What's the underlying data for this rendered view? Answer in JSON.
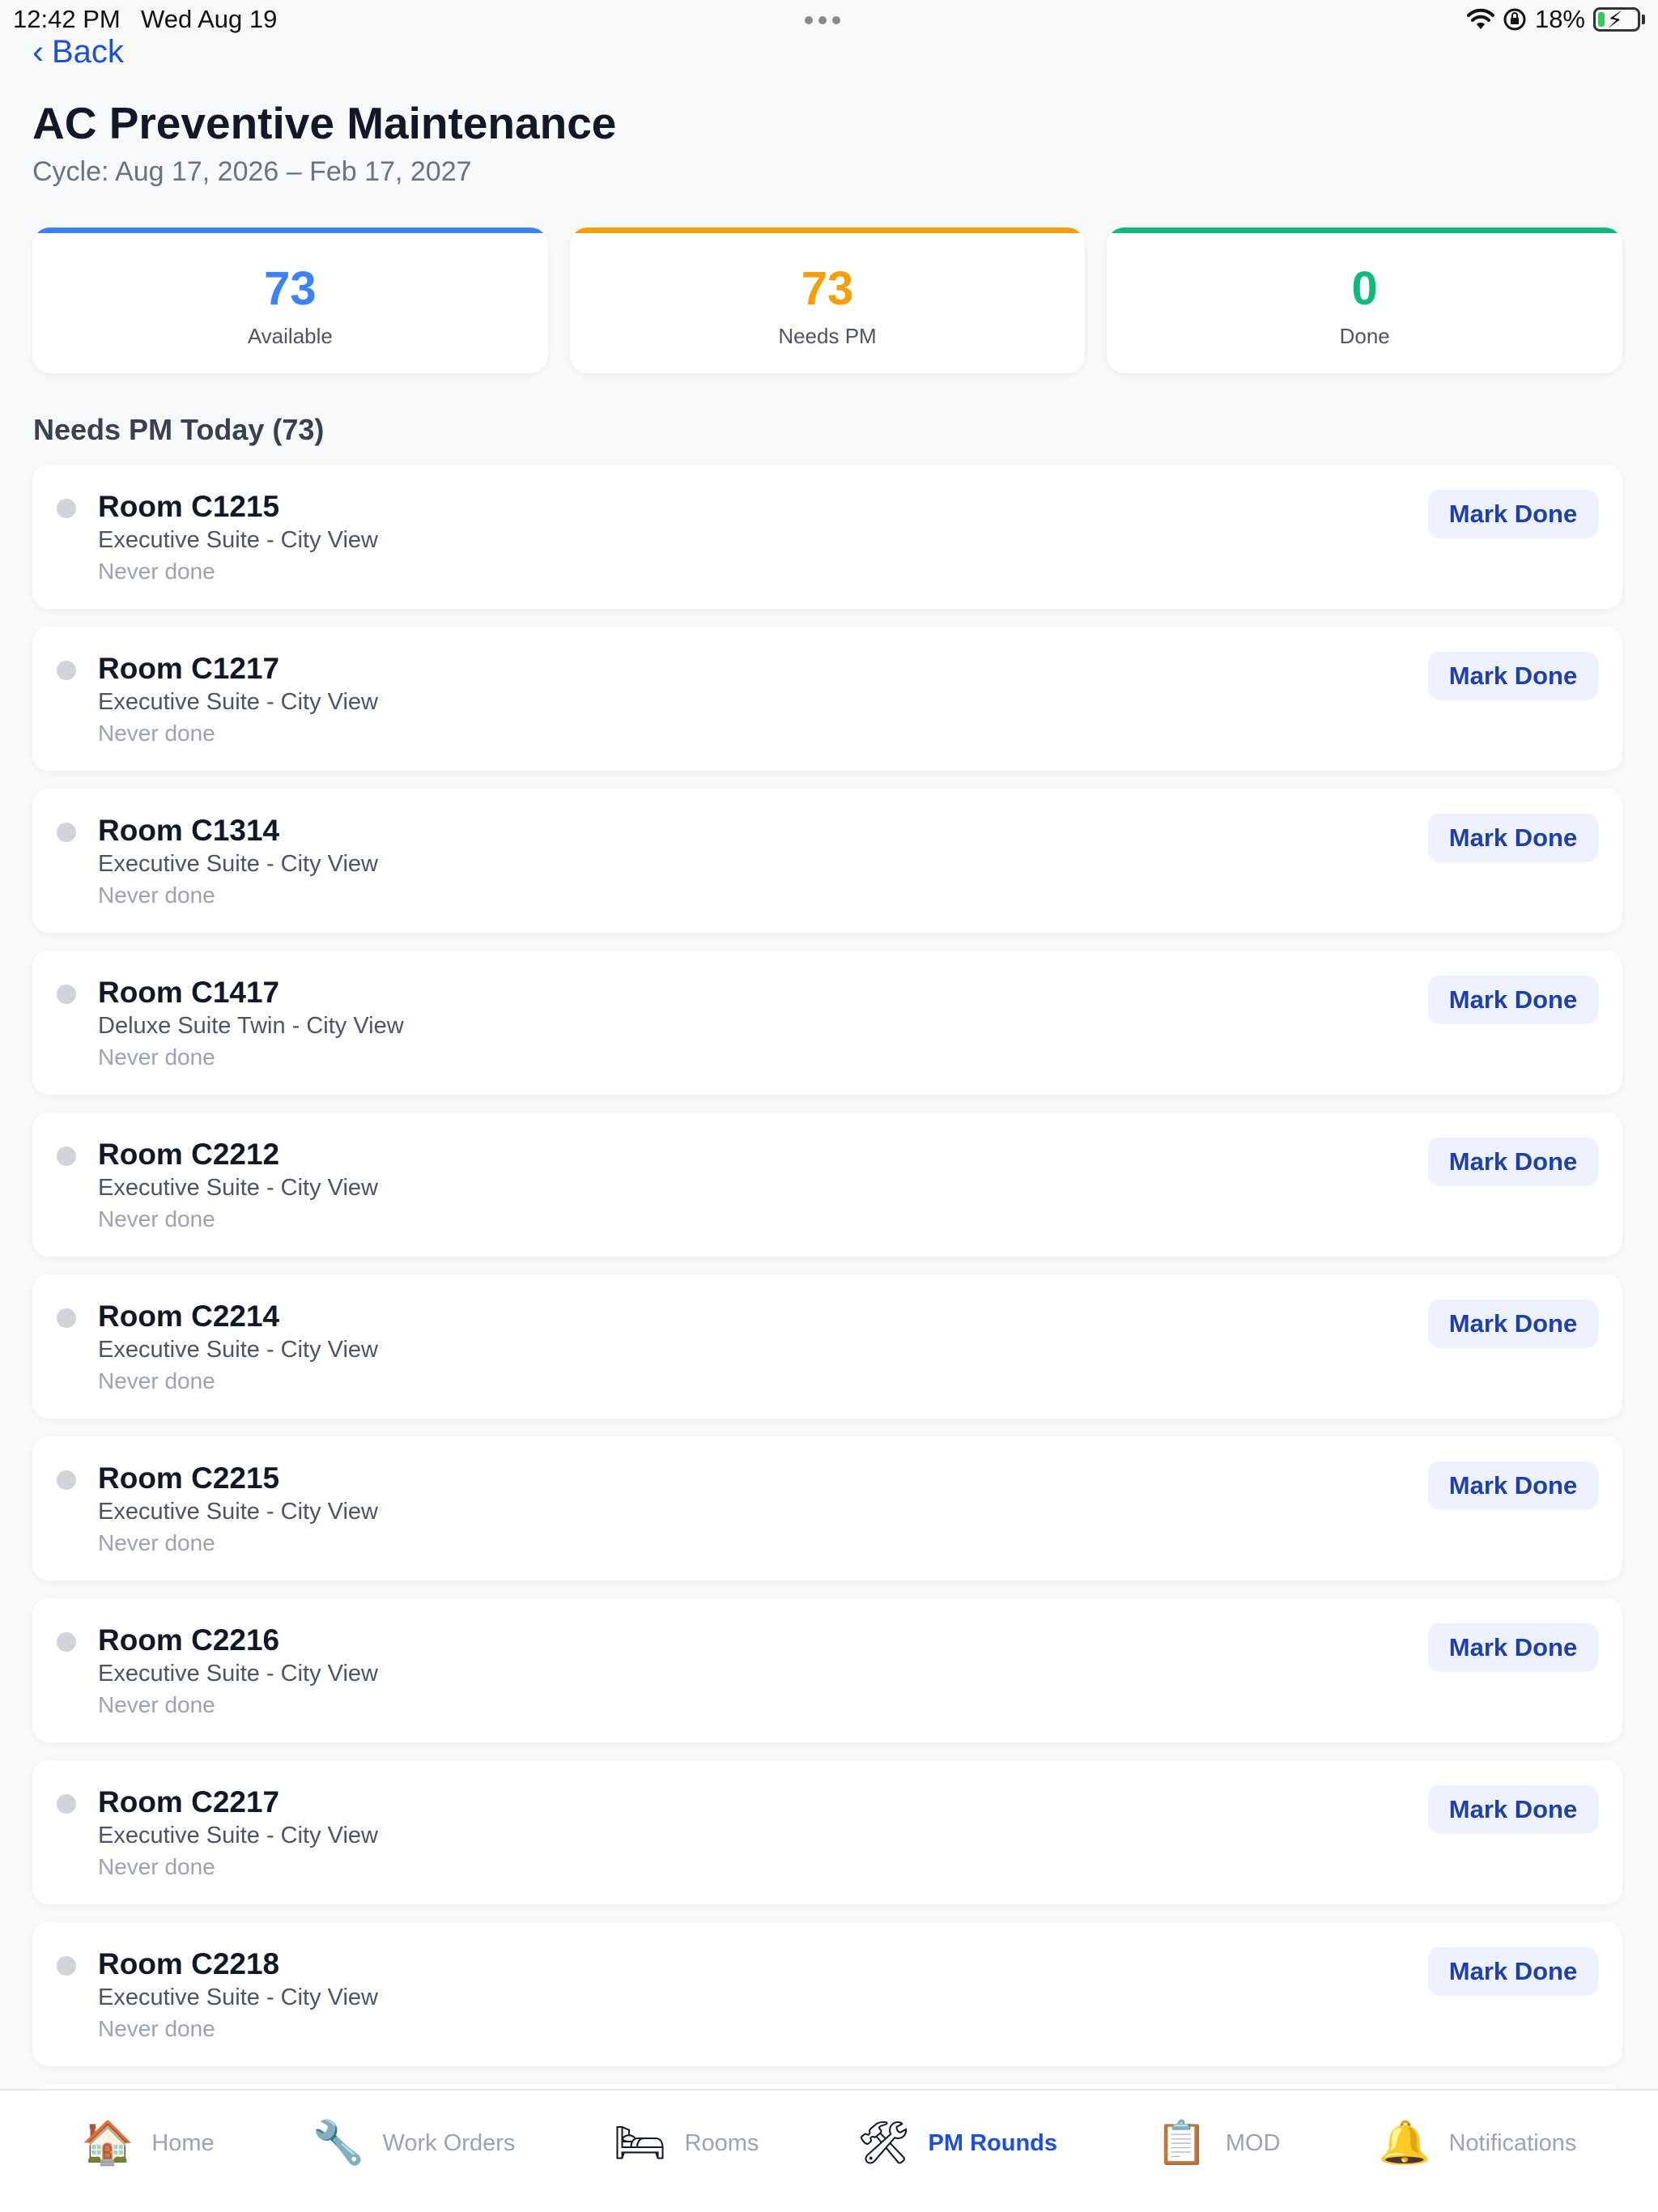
{
  "status_bar": {
    "time": "12:42 PM",
    "date": "Wed Aug 19",
    "battery": "18%",
    "battery_fill_fraction": 0.18,
    "icons": [
      "wifi-icon",
      "orientation-lock-icon",
      "battery-charging-icon"
    ]
  },
  "nav": {
    "back_label": "Back"
  },
  "header": {
    "title": "AC Preventive Maintenance",
    "cycle": "Cycle: Aug 17, 2026 – Feb 17, 2027"
  },
  "stats": [
    {
      "value": "73",
      "label": "Available",
      "color": "#3b82f6"
    },
    {
      "value": "73",
      "label": "Needs PM",
      "color": "#f59e0b"
    },
    {
      "value": "0",
      "label": "Done",
      "color": "#10b981"
    }
  ],
  "section": {
    "title": "Needs PM Today (73)"
  },
  "rooms": [
    {
      "name": "Room C1215",
      "type": "Executive Suite - City View",
      "last": "Never done",
      "action": "Mark Done"
    },
    {
      "name": "Room C1217",
      "type": "Executive Suite - City View",
      "last": "Never done",
      "action": "Mark Done"
    },
    {
      "name": "Room C1314",
      "type": "Executive Suite - City View",
      "last": "Never done",
      "action": "Mark Done"
    },
    {
      "name": "Room C1417",
      "type": "Deluxe Suite Twin - City View",
      "last": "Never done",
      "action": "Mark Done"
    },
    {
      "name": "Room C2212",
      "type": "Executive Suite - City View",
      "last": "Never done",
      "action": "Mark Done"
    },
    {
      "name": "Room C2214",
      "type": "Executive Suite - City View",
      "last": "Never done",
      "action": "Mark Done"
    },
    {
      "name": "Room C2215",
      "type": "Executive Suite - City View",
      "last": "Never done",
      "action": "Mark Done"
    },
    {
      "name": "Room C2216",
      "type": "Executive Suite - City View",
      "last": "Never done",
      "action": "Mark Done"
    },
    {
      "name": "Room C2217",
      "type": "Executive Suite - City View",
      "last": "Never done",
      "action": "Mark Done"
    },
    {
      "name": "Room C2218",
      "type": "Executive Suite - City View",
      "last": "Never done",
      "action": "Mark Done"
    }
  ],
  "tabbar": [
    {
      "label": "Home",
      "icon": "🏠",
      "icon_name": "house-icon",
      "active": false
    },
    {
      "label": "Work Orders",
      "icon": "🔧",
      "icon_name": "wrench-icon",
      "active": false
    },
    {
      "label": "Rooms",
      "icon": "🛏",
      "icon_name": "bed-icon",
      "active": false
    },
    {
      "label": "PM Rounds",
      "icon": "🛠",
      "icon_name": "hammer-and-wrench-icon",
      "active": true
    },
    {
      "label": "MOD",
      "icon": "📋",
      "icon_name": "clipboard-icon",
      "active": false
    },
    {
      "label": "Notifications",
      "icon": "🔔",
      "icon_name": "bell-icon",
      "active": false
    }
  ]
}
